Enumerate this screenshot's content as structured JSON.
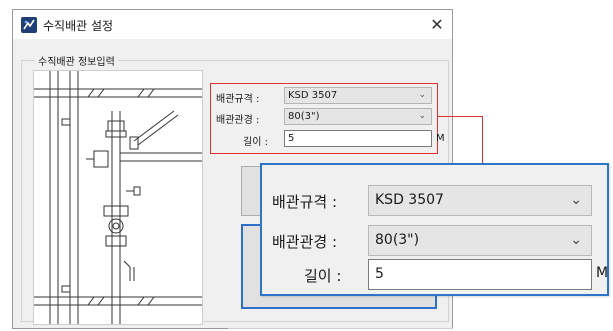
{
  "window": {
    "title": "수직배관 설정",
    "close_symbol": "✕"
  },
  "group": {
    "title": "수직배관 정보입력"
  },
  "fields": {
    "pipe_standard": {
      "label": "배관규격 :",
      "value": "KSD 3507"
    },
    "pipe_diameter": {
      "label": "배관관경 :",
      "value": "80(3\")"
    },
    "length": {
      "label": "길이 :",
      "value": "5",
      "unit": "M"
    }
  },
  "zoom": {
    "pipe_standard": {
      "label": "배관규격 :",
      "value": "KSD 3507"
    },
    "pipe_diameter": {
      "label": "배관관경 :",
      "value": "80(3\")"
    },
    "length": {
      "label": "길이 :",
      "value": "5",
      "unit": "M"
    }
  },
  "icons": {
    "dropdown": "chevron-down-icon",
    "app": "app-icon",
    "close": "close-icon"
  },
  "colors": {
    "highlight_red": "#e03030",
    "zoom_border_blue": "#2d75c8",
    "focus_blue": "#2d6fc9"
  }
}
